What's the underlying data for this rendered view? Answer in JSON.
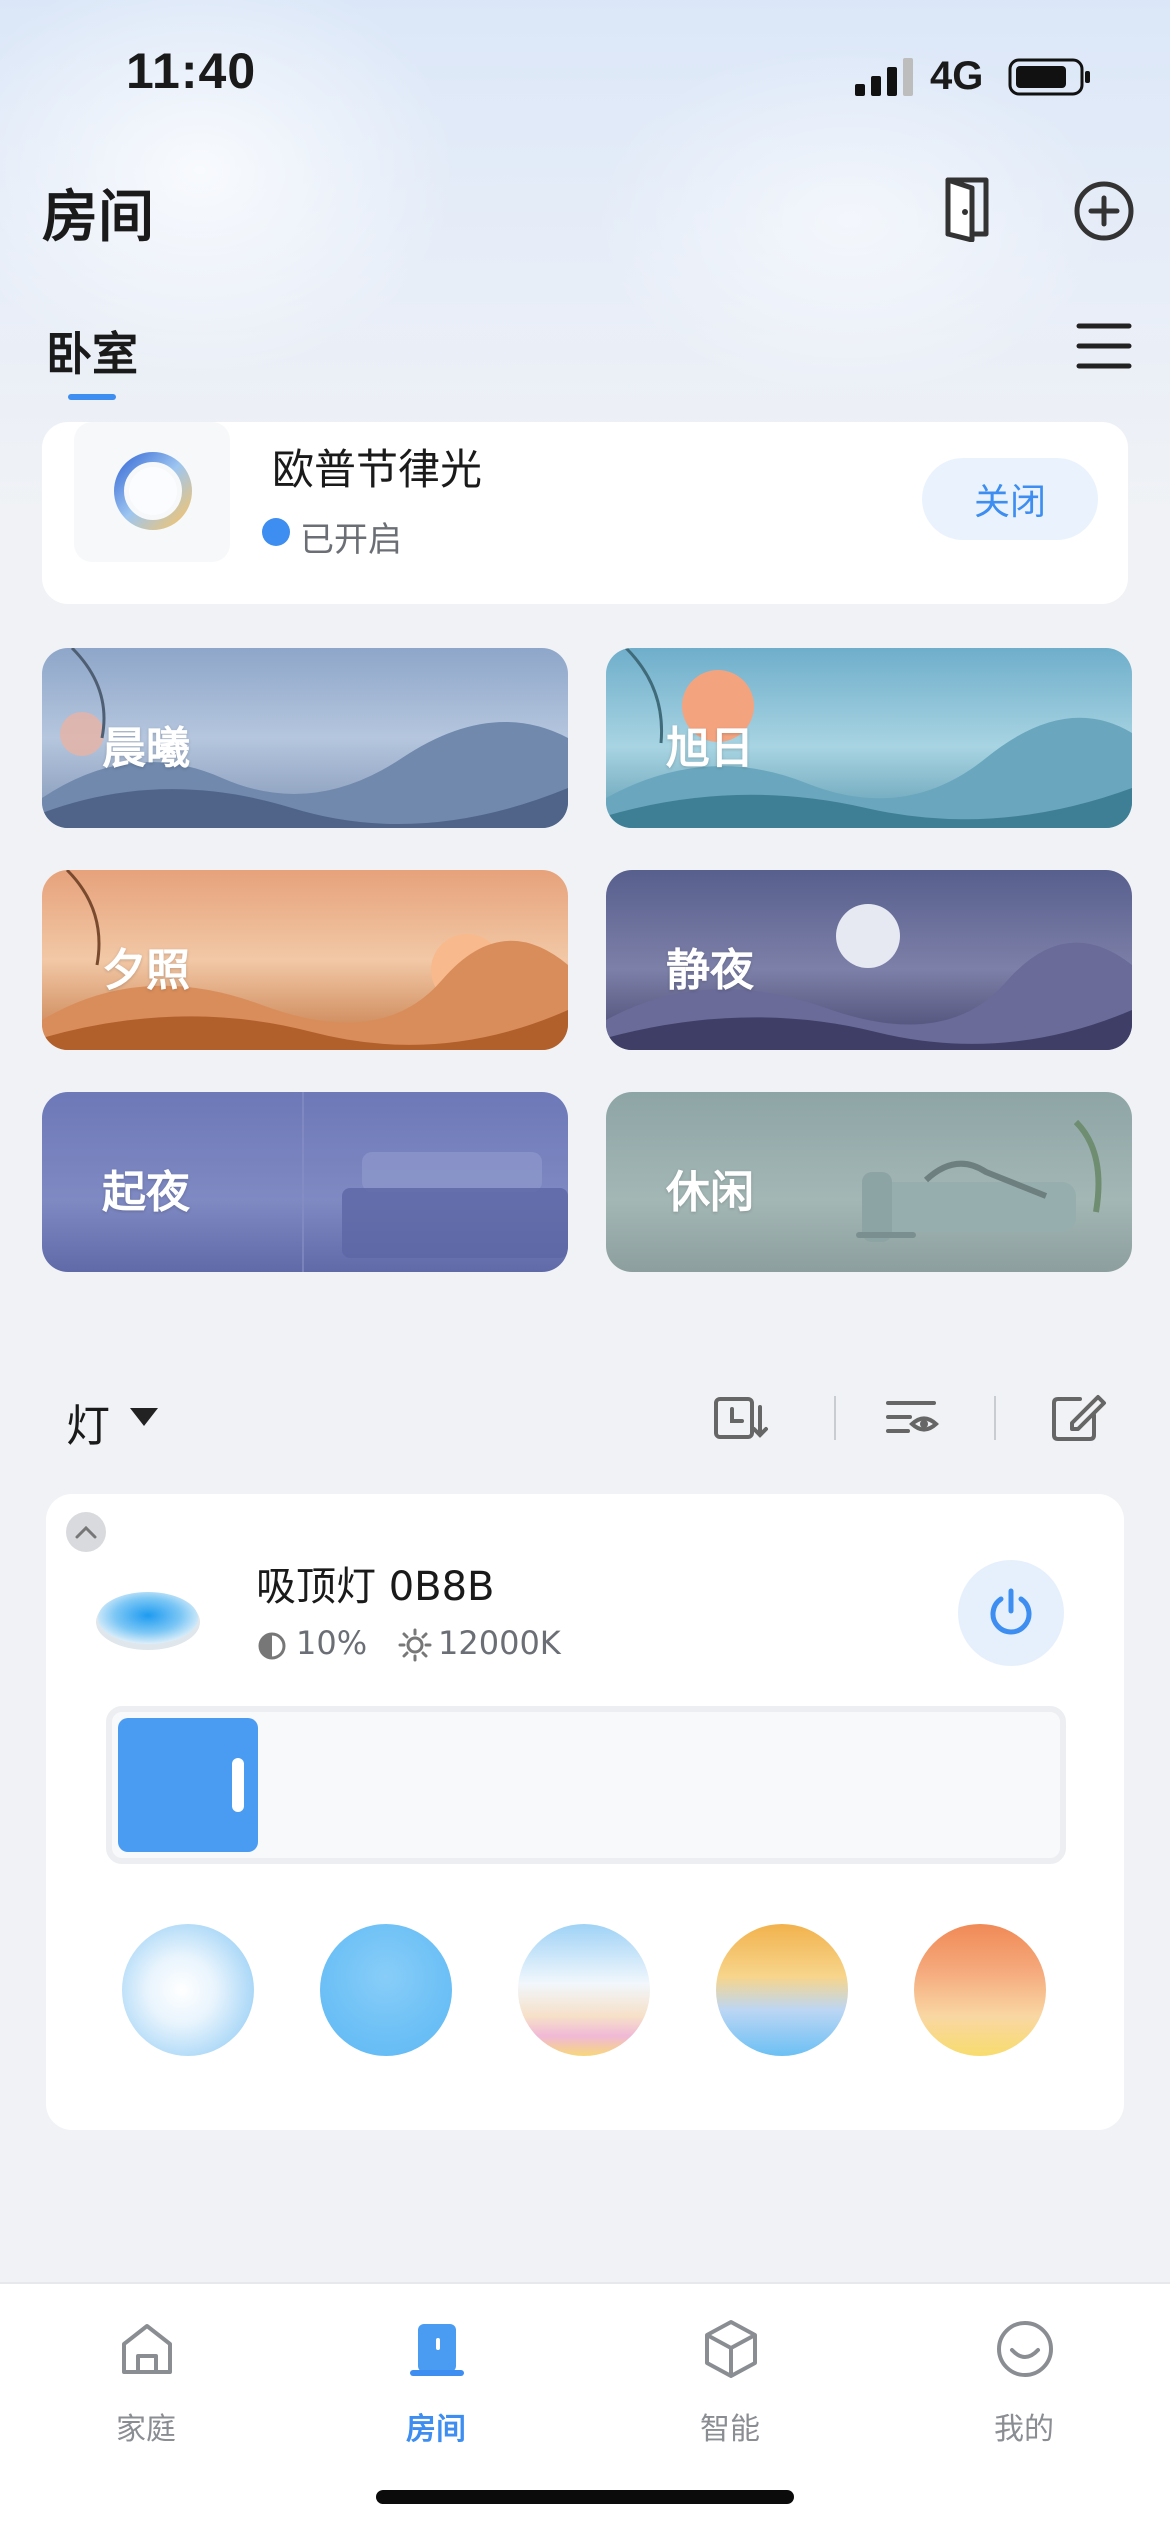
{
  "status_bar": {
    "time": "11:40",
    "network": "4G"
  },
  "header": {
    "title": "房间"
  },
  "room_tab": {
    "label": "卧室"
  },
  "device": {
    "name": "欧普节律光",
    "status": "已开启",
    "action_label": "关闭"
  },
  "scenes": [
    {
      "label": "晨曦"
    },
    {
      "label": "旭日"
    },
    {
      "label": "夕照"
    },
    {
      "label": "静夜"
    },
    {
      "label": "起夜"
    },
    {
      "label": "休闲"
    }
  ],
  "lights_section": {
    "title": "灯"
  },
  "lamp": {
    "name": "吸顶灯 0B8B",
    "brightness": "10%",
    "color_temp": "12000K",
    "brightness_fraction": 0.1
  },
  "colors": {
    "accent": "#3d8ef0",
    "slider": "#4a9cf2"
  },
  "bottom_nav": [
    {
      "label": "家庭",
      "icon": "home-icon"
    },
    {
      "label": "房间",
      "icon": "room-icon"
    },
    {
      "label": "智能",
      "icon": "cube-icon"
    },
    {
      "label": "我的",
      "icon": "smile-icon"
    }
  ]
}
